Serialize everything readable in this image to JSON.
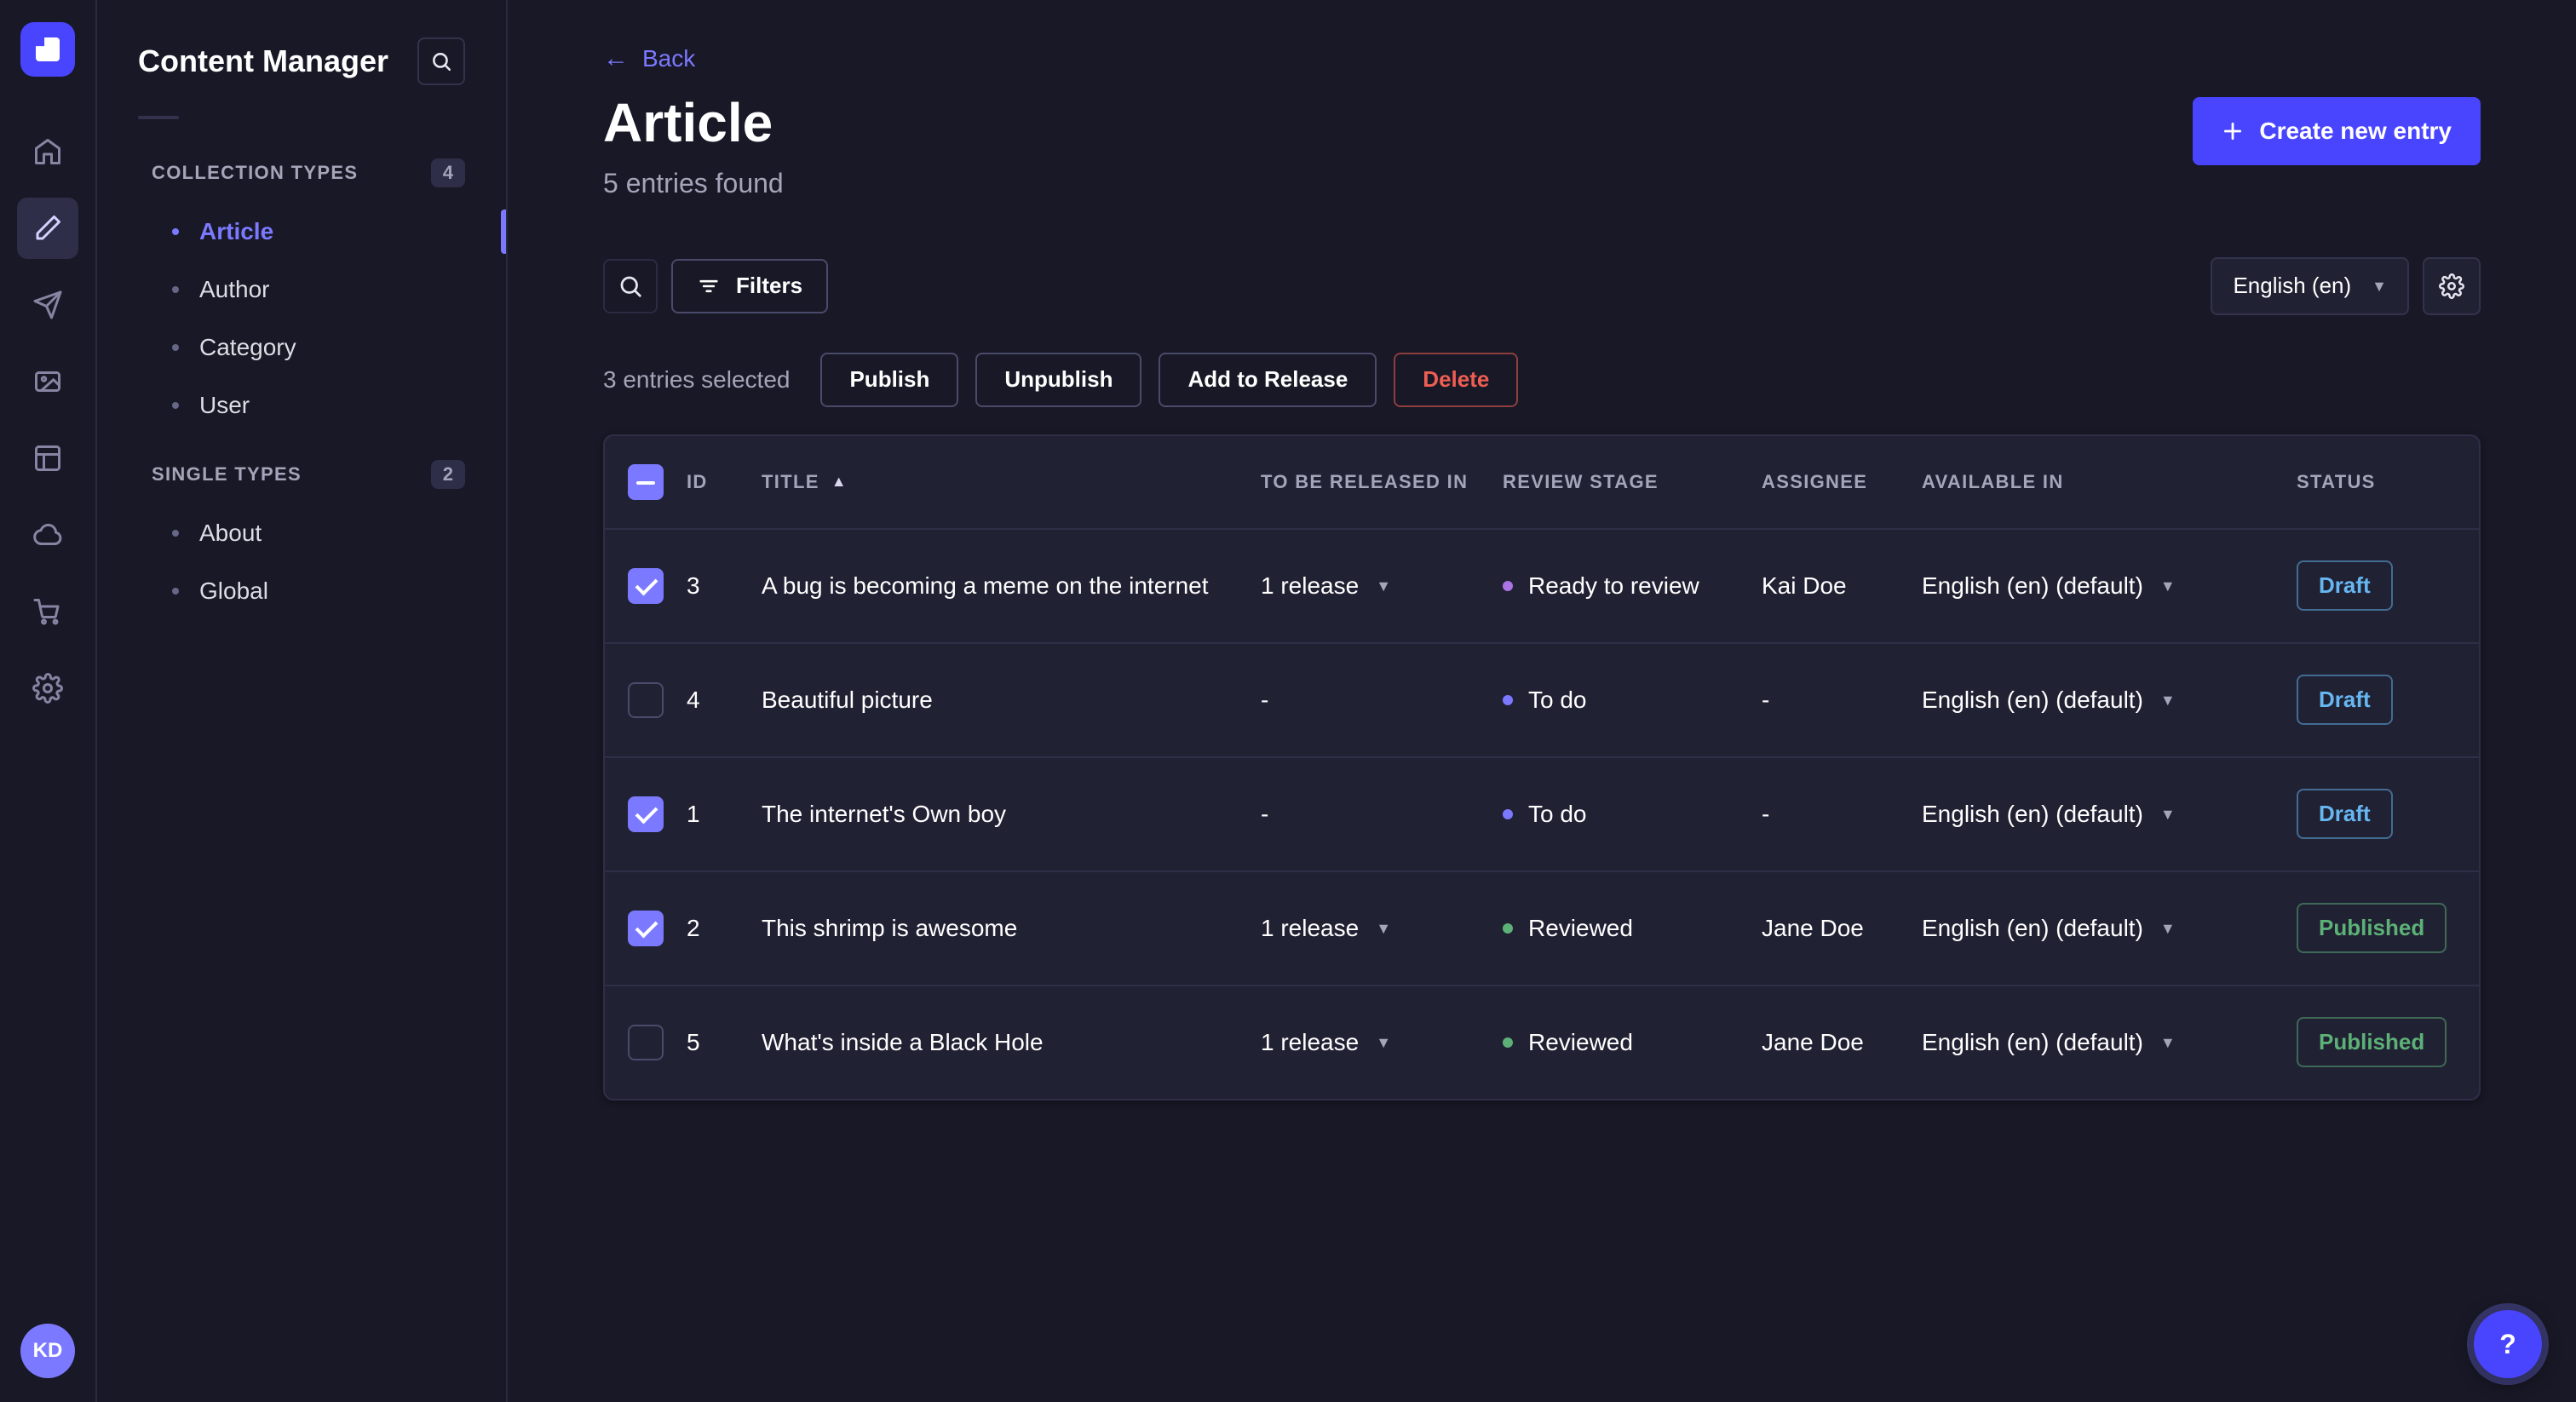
{
  "nav_rail": {
    "items": [
      {
        "name": "home"
      },
      {
        "name": "content-manager",
        "active": true
      },
      {
        "name": "releases"
      },
      {
        "name": "media-library"
      },
      {
        "name": "content-type-builder"
      },
      {
        "name": "deploy"
      },
      {
        "name": "marketplace"
      },
      {
        "name": "settings"
      }
    ],
    "avatar_initials": "KD"
  },
  "sidebar": {
    "title": "Content Manager",
    "sections": [
      {
        "label": "COLLECTION TYPES",
        "badge": "4",
        "items": [
          {
            "label": "Article",
            "active": true
          },
          {
            "label": "Author"
          },
          {
            "label": "Category"
          },
          {
            "label": "User"
          }
        ]
      },
      {
        "label": "SINGLE TYPES",
        "badge": "2",
        "items": [
          {
            "label": "About"
          },
          {
            "label": "Global"
          }
        ]
      }
    ]
  },
  "header": {
    "back_arrow": "←",
    "back_label": "Back",
    "title": "Article",
    "subtitle": "5 entries found",
    "create_button_label": "Create new entry"
  },
  "toolbar": {
    "filters_label": "Filters",
    "locale_selected": "English (en)",
    "caret": "▼"
  },
  "selection": {
    "count_text": "3 entries selected",
    "publish_label": "Publish",
    "unpublish_label": "Unpublish",
    "add_to_release_label": "Add to Release",
    "delete_label": "Delete"
  },
  "table": {
    "select_all_state": "indeterminate",
    "caret": "▼",
    "headers": {
      "id": "ID",
      "title": "TITLE",
      "sort_asc": "▲",
      "to_be_released_in": "TO BE RELEASED IN",
      "review_stage": "REVIEW STAGE",
      "assignee": "ASSIGNEE",
      "available_in": "AVAILABLE IN",
      "status": "STATUS"
    },
    "rows": [
      {
        "checkbox": "checked",
        "id": "3",
        "title": "A bug is becoming a meme on the internet",
        "release": "1 release",
        "review_stage": "Ready to review",
        "review_variant": "purple",
        "assignee": "Kai Doe",
        "available_in": "English (en) (default)",
        "status": "Draft",
        "status_variant": "draft"
      },
      {
        "checkbox": "unchecked",
        "id": "4",
        "title": "Beautiful picture",
        "release": "-",
        "no_release_menu": true,
        "review_stage": "To do",
        "review_variant": "blue",
        "assignee": "-",
        "available_in": "English (en) (default)",
        "status": "Draft",
        "status_variant": "draft"
      },
      {
        "checkbox": "checked",
        "id": "1",
        "title": "The internet's Own boy",
        "release": "-",
        "no_release_menu": true,
        "review_stage": "To do",
        "review_variant": "blue",
        "assignee": "-",
        "available_in": "English (en) (default)",
        "status": "Draft",
        "status_variant": "draft"
      },
      {
        "checkbox": "checked",
        "id": "2",
        "title": "This shrimp is awesome",
        "release": "1 release",
        "review_stage": "Reviewed",
        "review_variant": "green",
        "assignee": "Jane Doe",
        "available_in": "English (en) (default)",
        "status": "Published",
        "status_variant": "published"
      },
      {
        "checkbox": "unchecked",
        "id": "5",
        "title": "What's inside a Black Hole",
        "release": "1 release",
        "review_stage": "Reviewed",
        "review_variant": "green",
        "assignee": "Jane Doe",
        "available_in": "English (en) (default)",
        "status": "Published",
        "status_variant": "published"
      }
    ]
  },
  "help": {
    "label": "?"
  },
  "colors": {
    "primary": "#4945ff",
    "primary_light": "#7b79ff",
    "page_bg": "#181826",
    "card_bg": "#212134",
    "border": "#32324d",
    "text_muted": "#a5a5ba",
    "danger": "#ee5e52",
    "success_published": "#5cb176",
    "draft_blue": "#66b7f1",
    "stage_ready_to_review": "#ac73e6",
    "stage_to_do": "#7b79ff",
    "stage_reviewed": "#5cb176"
  }
}
